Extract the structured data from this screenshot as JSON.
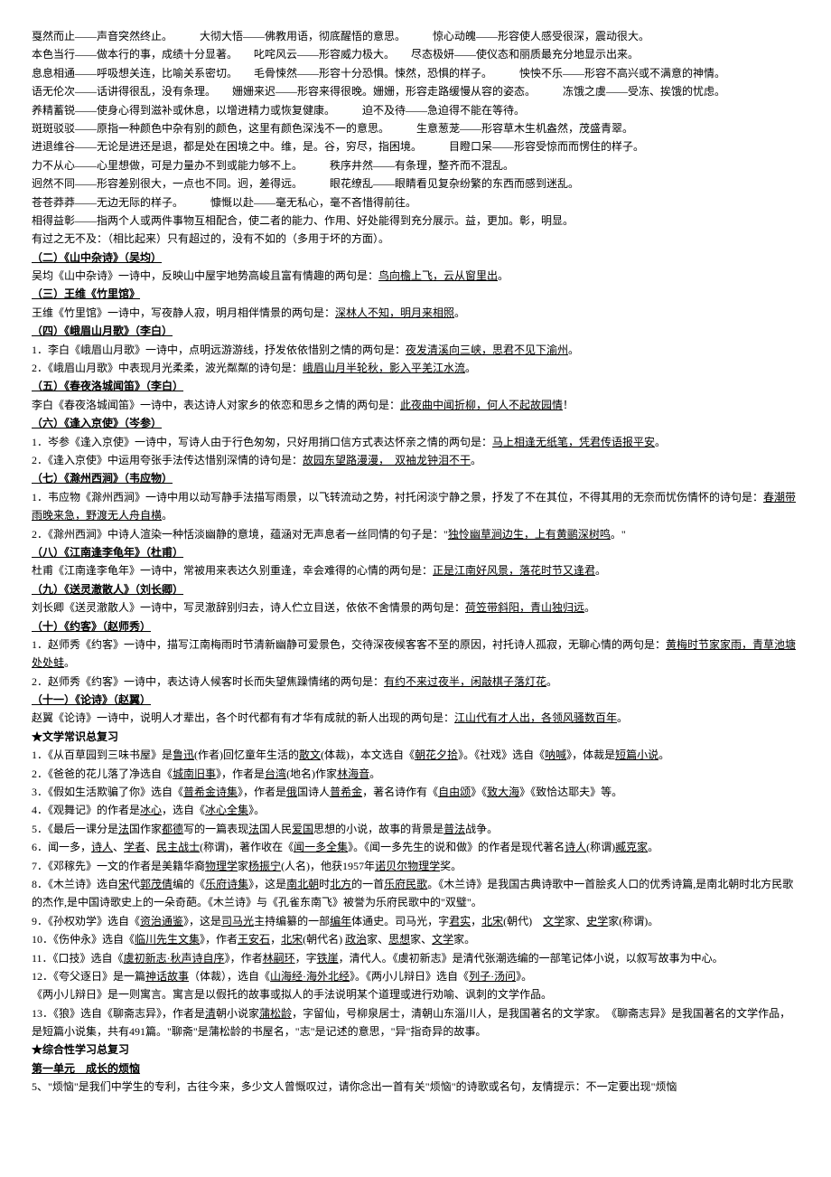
{
  "vocab": [
    "戛然而止——声音突然终止。　　　大彻大悟——佛教用语，彻底醒悟的意思。　　　惊心动魄——形容使人感受很深，震动很大。",
    "本色当行——做本行的事，成绩十分显著。　　叱咤风云——形容威力极大。　　尽态极妍——使仪态和丽质最充分地显示出来。",
    "息息相通——呼吸想关连，比喻关系密切。　　毛骨悚然——形容十分恐惧。悚然，恐惧的样子。　　　怏怏不乐——形容不高兴或不满意的神情。",
    "语无伦次——话讲得很乱，没有条理。　　姗姗来迟——形容来得很晚。姗姗，形容走路缓慢从容的姿态。　　　冻饿之虞——受冻、挨饿的忧虑。",
    "养精蓄锐——使身心得到滋补或休息，以增进精力或恢复健康。　　　迫不及待——急迫得不能在等待。",
    "斑斑驳驳——原指一种颜色中杂有别的颜色，这里有颜色深浅不一的意思。　　　生意葱茏——形容草木生机盎然，茂盛青翠。",
    "进退维谷——无论是进还是退，都是处在困境之中。维，是。谷，穷尽，指困境。　　　目瞪口呆——形容受惊而而愣住的样子。",
    "力不从心——心里想做，可是力量办不到或能力够不上。　　　秩序井然——有条理，整齐而不混乱。",
    "迥然不同——形容差别很大，一点也不同。迥，差得远。　　　眼花缭乱——眼睛看见复杂纷繁的东西而感到迷乱。",
    "苍苍莽莽——无边无际的样子。　　　慷慨以赴——毫无私心，毫不吝惜得前往。",
    "相得益彰——指两个人或两件事物互相配合，使二者的能力、作用、好处能得到充分展示。益，更加。彰，明显。",
    "有过之无不及：（相比起来）只有超过的，没有不如的（多用于坏的方面）。"
  ],
  "sections": [
    {
      "title": "（二）《山中杂诗》（吴均）",
      "lines": [
        {
          "pre": "吴均《山中杂诗》一诗中，反映山中屋宇地势高峻且富有情趣的两句是：",
          "u": "鸟向檐上飞，云从窗里出",
          "post": "。"
        }
      ]
    },
    {
      "title": "（三）王维《竹里馆》",
      "lines": [
        {
          "pre": "王维《竹里馆》一诗中，写夜静人寂，明月相伴情景的两句是：",
          "u": "深林人不知，明月来相照",
          "post": "。"
        }
      ]
    },
    {
      "title": "（四）《峨眉山月歌》（李白）",
      "lines": [
        {
          "pre": "1．李白《峨眉山月歌》一诗中，点明远游游线，抒发依依惜别之情的两句是：",
          "u": "夜发清溪向三峡，思君不见下渝州",
          "post": "。"
        },
        {
          "pre": "2．《峨眉山月歌》中表现月光柔柔，波光粼粼的诗句是：",
          "u": "峨眉山月半轮秋，影入平羌江水流",
          "post": "。"
        }
      ]
    },
    {
      "title": "（五）《春夜洛城闻笛》（李白）",
      "lines": [
        {
          "pre": "李白《春夜洛城闻笛》一诗中，表达诗人对家乡的依恋和思乡之情的两句是：",
          "u": "此夜曲中闻折柳，何人不起故园情",
          "post": "！"
        }
      ]
    },
    {
      "title": "（六）《逢入京使》（岑参）",
      "lines": [
        {
          "pre": "1．岑参《逢入京使》一诗中，写诗人由于行色匆匆，只好用捎口信方式表达怀亲之情的两句是：",
          "u": "马上相逢无纸笔，凭君传语报平安",
          "post": "。"
        },
        {
          "pre": "2．《逢入京使》中运用夸张手法传达惜别深情的诗句是：",
          "u": "故园东望路漫漫，　双袖龙钟泪不干",
          "post": "。"
        }
      ]
    },
    {
      "title": "（七）《滁州西涧》（韦应物）",
      "lines": [
        {
          "pre": "1．韦应物《滁州西涧》一诗中用以动写静手法描写雨景，以飞转流动之势，衬托闲淡宁静之景，抒发了不在其位，不得其用的无奈而忧伤情怀的诗句是：",
          "u": "春潮带雨晚来急，野渡无人舟自横",
          "post": "。"
        },
        {
          "pre": "2．《滁州西涧》中诗人渲染一种恬淡幽静的意境，蕴涵对无声息者一丝同情的句子是：\"",
          "u": "独怜幽草涧边生，上有黄鹂深树鸣",
          "post": "。\""
        }
      ]
    },
    {
      "title": "（八）《江南逢李龟年》（杜甫）",
      "lines": [
        {
          "pre": "杜甫《江南逢李龟年》一诗中，常被用来表达久别重逢，幸会难得的心情的两句是：",
          "u": "正是江南好风景，落花时节又逢君",
          "post": "。"
        }
      ]
    },
    {
      "title": "（九）《送灵澈散人》（刘长卿）",
      "lines": [
        {
          "pre": "刘长卿《送灵澈散人》一诗中，写灵澈辞别归去，诗人伫立目送，依依不舍情景的两句是：",
          "u": "荷笠带斜阳，青山独归远",
          "post": "。"
        }
      ]
    },
    {
      "title": "（十）《约客》（赵师秀）",
      "lines": [
        {
          "pre": "1．赵师秀《约客》一诗中，描写江南梅雨时节清新幽静可爱景色，交待深夜候客客不至的原因，衬托诗人孤寂，无聊心情的两句是：",
          "u": "黄梅时节家家雨，青草池塘处处蛙",
          "post": "。"
        },
        {
          "pre": "2．赵师秀《约客》一诗中，表达诗人候客时长而失望焦躁情绪的两句是：",
          "u": "有约不来过夜半，闲敲棋子落灯花",
          "post": "。"
        }
      ]
    },
    {
      "title": "（十一）《论诗》（赵翼）",
      "lines": [
        {
          "pre": "赵翼《论诗》一诗中，说明人才辈出，各个时代都有有才华有成就的新人出现的两句是：",
          "u": "江山代有才人出，各领风骚数百年",
          "post": "。"
        }
      ]
    }
  ],
  "litTitle": "★文学常识总复习",
  "lit": [
    [
      {
        "t": "1．《从百草园到三味书屋》是"
      },
      {
        "u": "鲁迅"
      },
      {
        "t": "(作者)回忆童年生活的"
      },
      {
        "u": "散文"
      },
      {
        "t": "(体裁)，本文选自《"
      },
      {
        "u": "朝花夕拾"
      },
      {
        "t": "》。《社戏》选自《"
      },
      {
        "u": "呐喊"
      },
      {
        "t": "》，体裁是"
      },
      {
        "u": "短篇小说"
      },
      {
        "t": "。"
      }
    ],
    [
      {
        "t": "2．《爸爸的花儿落了净选自《"
      },
      {
        "u": "城南旧事"
      },
      {
        "t": "》，作者是"
      },
      {
        "u": "台湾"
      },
      {
        "t": "(地名)作家"
      },
      {
        "u": "林海音"
      },
      {
        "t": "。"
      }
    ],
    [
      {
        "t": "3．《假如生活欺骗了你》选自《"
      },
      {
        "u": "普希金诗集"
      },
      {
        "t": "》，作者是"
      },
      {
        "u": "俄"
      },
      {
        "t": "国诗人"
      },
      {
        "u": "普希金"
      },
      {
        "t": "，著名诗作有《"
      },
      {
        "u": "自由颂"
      },
      {
        "t": "》《"
      },
      {
        "u": "致大海"
      },
      {
        "t": "》《致恰达耶夫》等。"
      }
    ],
    [
      {
        "t": "4．《观舞记》的作者是"
      },
      {
        "u": "冰心"
      },
      {
        "t": "，选自《"
      },
      {
        "u": "冰心全集"
      },
      {
        "t": "》。"
      }
    ],
    [
      {
        "t": "5．《最后一课分是"
      },
      {
        "u": "法"
      },
      {
        "t": "国作家"
      },
      {
        "u": "都德"
      },
      {
        "t": "写的一篇表现"
      },
      {
        "u": "法"
      },
      {
        "t": "国人民"
      },
      {
        "u": "爱国"
      },
      {
        "t": "思想的小说，故事的背景是"
      },
      {
        "u": "普法"
      },
      {
        "t": "战争。"
      }
    ],
    [
      {
        "t": "6．闻一多，"
      },
      {
        "u": "诗人"
      },
      {
        "t": "、"
      },
      {
        "u": "学者"
      },
      {
        "t": "、"
      },
      {
        "u": "民主战士"
      },
      {
        "t": "(称谓)，著作收在《"
      },
      {
        "u": "闻一多全集"
      },
      {
        "t": "》。《闻一多先生的说和做》的作者是现代著名"
      },
      {
        "u": "诗人"
      },
      {
        "t": "(称谓)"
      },
      {
        "u": "臧克家"
      },
      {
        "t": "。"
      }
    ],
    [
      {
        "t": "7．《邓稼先》一文的作者是美籍华裔"
      },
      {
        "u": "物理学"
      },
      {
        "t": "家"
      },
      {
        "u": "杨振宁"
      },
      {
        "t": "(人名)，他获1957年"
      },
      {
        "u": "诺贝尔物理学"
      },
      {
        "t": "奖。"
      }
    ],
    [
      {
        "t": "8．《木兰诗》选自"
      },
      {
        "u": "宋"
      },
      {
        "t": "代"
      },
      {
        "u": "郭茂倩"
      },
      {
        "t": "编的《"
      },
      {
        "u": "乐府诗集"
      },
      {
        "t": "》，这是"
      },
      {
        "u": "南北朝"
      },
      {
        "t": "时"
      },
      {
        "u": "北方"
      },
      {
        "t": "的一首"
      },
      {
        "u": "乐府民歌"
      },
      {
        "t": "。《木兰诗》是我国古典诗歌中一首脍炙人口的优秀诗篇,是南北朝时北方民歌的杰作,是中国诗歌史上的一朵奇葩。《木兰诗》与《孔雀东南飞》被誉为乐府民歌中的\"双璧\"。"
      }
    ],
    [
      {
        "t": "9．《孙权劝学》选自《"
      },
      {
        "u": "资治通鉴"
      },
      {
        "t": "》，这是"
      },
      {
        "u": "司马光"
      },
      {
        "t": "主持编纂的一部"
      },
      {
        "u": "编年"
      },
      {
        "t": "体通史。司马光，字"
      },
      {
        "u": "君实"
      },
      {
        "t": "，"
      },
      {
        "u": "北宋"
      },
      {
        "t": "(朝代)　"
      },
      {
        "u": "文学"
      },
      {
        "t": "家、"
      },
      {
        "u": "史学"
      },
      {
        "t": "家(称谓)。"
      }
    ],
    [
      {
        "t": "10．《伤仲永》选自《"
      },
      {
        "u": "临川先生文集"
      },
      {
        "t": "》，作者"
      },
      {
        "u": "王安石"
      },
      {
        "t": "，"
      },
      {
        "u": "北宋"
      },
      {
        "t": "(朝代名) "
      },
      {
        "u": "政治"
      },
      {
        "t": "家、"
      },
      {
        "u": "思想"
      },
      {
        "t": "家、"
      },
      {
        "u": "文学"
      },
      {
        "t": "家。"
      }
    ],
    [
      {
        "t": "11．《口技》选自《"
      },
      {
        "u": "虞初新志·秋声诗自序"
      },
      {
        "t": "》，作者"
      },
      {
        "u": "林嗣环"
      },
      {
        "t": "，字"
      },
      {
        "u": "铁崖"
      },
      {
        "t": "，清代人。《虞初新志》是清代张潮选编的一部笔记体小说，以叙写故事为中心。"
      }
    ],
    [
      {
        "t": "12．《夸父逐日》是一篇"
      },
      {
        "u": "神话故事"
      },
      {
        "t": "（体裁），选自《"
      },
      {
        "u": "山海经·海外北经"
      },
      {
        "t": "》。《两小儿辩日》选自《"
      },
      {
        "u": "列子·汤问"
      },
      {
        "t": "》。"
      }
    ],
    [
      {
        "t": "《两小儿辩日》是一则寓言。寓言是以假托的故事或拟人的手法说明某个道理或进行劝喻、讽刺的文学作品。"
      }
    ],
    [
      {
        "t": "13．《狼》选自《聊斋志异》，作者是"
      },
      {
        "u": "清"
      },
      {
        "t": "朝小说家"
      },
      {
        "u": "蒲松龄"
      },
      {
        "t": "，字留仙，号柳泉居士，清朝山东淄川人，是我国著名的文学家。　《聊斋志异》是我国著名的文学作品，是短篇小说集，共有491篇。\"聊斋\"是蒲松龄的书屋名，\"志\"是记述的意思，\"异\"指奇异的故事。"
      }
    ]
  ],
  "studyTitle": "★综合性学习总复习",
  "unitTitle": "第一单元　成长的烦恼",
  "studyLine": "5、\"烦恼\"是我们中学生的专利，古往今来，多少文人曾慨叹过，请你念出一首有关\"烦恼\"的诗歌或名句，友情提示：不一定要出现\"烦恼"
}
